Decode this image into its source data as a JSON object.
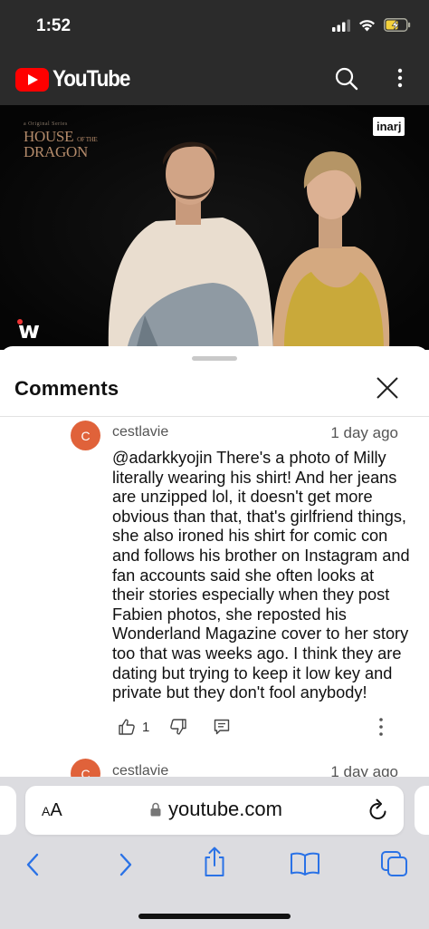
{
  "status_bar": {
    "time": "1:52"
  },
  "youtube": {
    "logo_text": "YouTube"
  },
  "video": {
    "show_small": "a Original Series",
    "show_line1": "HOUSE",
    "show_of": "OF THE",
    "show_line2": "DRAGON",
    "badge_inarj": "inarj",
    "badge_w": "w"
  },
  "comments": {
    "title": "Comments",
    "items": [
      {
        "avatar_letter": "C",
        "author": "cestlavie",
        "time": "1 day ago",
        "text": " @adarkkyojin  There's a photo of Milly\nliterally wearing his shirt! And her jeans\nare unzipped lol, it doesn't get more\nobvious than that, that's girlfriend things,\nshe also ironed his shirt for comic con\nand follows his brother on Instagram and\nfan accounts said she often looks at\ntheir stories especially when they post\nFabien photos, she reposted his\nWonderland Magazine cover to her story\ntoo that was weeks ago. I think they are\ndating but trying to keep it low key and\nprivate but they don't fool anybody!",
        "likes": "1"
      },
      {
        "avatar_letter": "C",
        "author": "cestlavie",
        "time": "1 day ago"
      }
    ]
  },
  "safari": {
    "aa_small": "A",
    "aa_large": "A",
    "url": "youtube.com"
  },
  "colors": {
    "accent": "#007aff",
    "youtube_red": "#ff0000",
    "avatar": "#e0623a",
    "header_bg": "#2b2b2b"
  }
}
